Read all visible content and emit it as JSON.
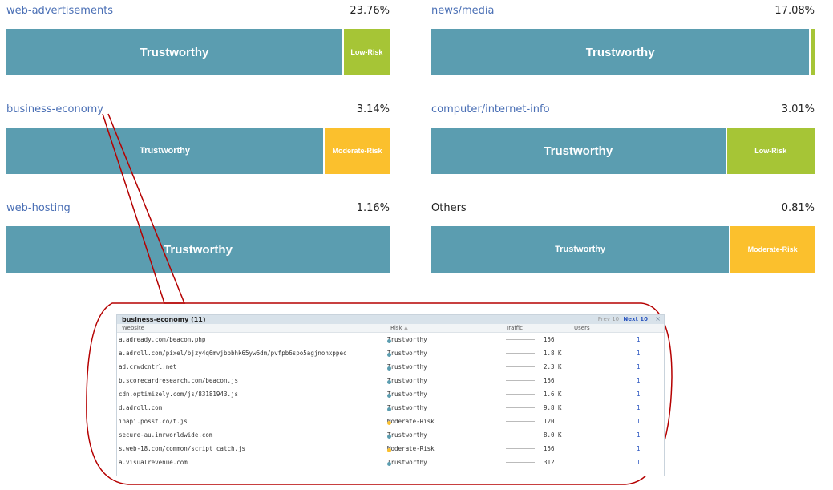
{
  "colors": {
    "trustworthy": "#5b9db0",
    "low_risk": "#a6c536",
    "moderate_risk": "#fbc02d",
    "link": "#4a6fb5",
    "callout": "#b50000"
  },
  "categories": [
    {
      "name": "web-advertisements",
      "percent": "23.76%",
      "segments": [
        {
          "label": "Trustworthy",
          "level": "t",
          "share": 0.88
        },
        {
          "label": "Low-Risk",
          "level": "l",
          "share": 0.12
        }
      ]
    },
    {
      "name": "news/media",
      "percent": "17.08%",
      "segments": [
        {
          "label": "Trustworthy",
          "level": "t",
          "share": 0.99
        },
        {
          "label": "",
          "level": "l",
          "share": 0.01
        }
      ]
    },
    {
      "name": "business-economy",
      "percent": "3.14%",
      "segments": [
        {
          "label": "Trustworthy",
          "level": "t",
          "share": 0.83
        },
        {
          "label": "Moderate-Risk",
          "level": "m",
          "share": 0.17
        }
      ]
    },
    {
      "name": "computer/internet-info",
      "percent": "3.01%",
      "segments": [
        {
          "label": "Trustworthy",
          "level": "t",
          "share": 0.77
        },
        {
          "label": "Low-Risk",
          "level": "l",
          "share": 0.23
        }
      ]
    },
    {
      "name": "web-hosting",
      "percent": "1.16%",
      "segments": [
        {
          "label": "Trustworthy",
          "level": "t",
          "share": 1.0
        }
      ]
    },
    {
      "name": "Others",
      "percent": "0.81%",
      "segments": [
        {
          "label": "Trustworthy",
          "level": "t",
          "share": 0.78
        },
        {
          "label": "Moderate-Risk",
          "level": "m",
          "share": 0.22
        }
      ]
    }
  ],
  "detail": {
    "title": "business-economy (11)",
    "prev_label": "Prev 10",
    "next_label": "Next 10",
    "close_label": "×",
    "columns": {
      "website": "Website",
      "risk": "Risk",
      "traffic": "Traffic",
      "users": "Users"
    },
    "rows": [
      {
        "website": "a.adready.com/beacon.php",
        "risk": "Trustworthy",
        "level": "t",
        "traffic": "156",
        "users": "1"
      },
      {
        "website": "a.adroll.com/pixel/bjzy4q6mvjbbbhk65yw6dm/pvfpb6spo5agjnohxppec",
        "risk": "Trustworthy",
        "level": "t",
        "traffic": "1.8 K",
        "users": "1"
      },
      {
        "website": "ad.crwdcntrl.net",
        "risk": "Trustworthy",
        "level": "t",
        "traffic": "2.3 K",
        "users": "1"
      },
      {
        "website": "b.scorecardresearch.com/beacon.js",
        "risk": "Trustworthy",
        "level": "t",
        "traffic": "156",
        "users": "1"
      },
      {
        "website": "cdn.optimizely.com/js/83181943.js",
        "risk": "Trustworthy",
        "level": "t",
        "traffic": "1.6 K",
        "users": "1"
      },
      {
        "website": "d.adroll.com",
        "risk": "Trustworthy",
        "level": "t",
        "traffic": "9.8 K",
        "users": "1"
      },
      {
        "website": "inapi.posst.co/t.js",
        "risk": "Moderate-Risk",
        "level": "m",
        "traffic": "120",
        "users": "1"
      },
      {
        "website": "secure-au.imrworldwide.com",
        "risk": "Trustworthy",
        "level": "t",
        "traffic": "8.0 K",
        "users": "1"
      },
      {
        "website": "s.web-18.com/common/script_catch.js",
        "risk": "Moderate-Risk",
        "level": "m",
        "traffic": "156",
        "users": "1"
      },
      {
        "website": "a.visualrevenue.com",
        "risk": "Trustworthy",
        "level": "t",
        "traffic": "312",
        "users": "1"
      }
    ]
  }
}
